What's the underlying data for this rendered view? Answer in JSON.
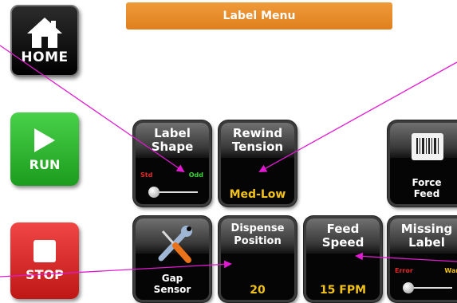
{
  "header": {
    "title": "Label Menu"
  },
  "side_buttons": {
    "home_label": "HOME",
    "run_label": "RUN",
    "stop_label": "STOP"
  },
  "tiles": {
    "label_shape": {
      "title_line1": "Label",
      "title_line2": "Shape",
      "left_text": "Std",
      "right_text": "Odd"
    },
    "rewind_tension": {
      "title_line1": "Rewind",
      "title_line2": "Tension",
      "value": "Med-Low"
    },
    "force_feed": {
      "bottom_line1": "Force",
      "bottom_line2": "Feed"
    },
    "gap_sensor": {
      "bottom_line1": "Gap",
      "bottom_line2": "Sensor"
    },
    "dispense_position": {
      "title_line1": "Dispense",
      "title_line2": "Position",
      "value": "20"
    },
    "feed_speed": {
      "title_line1": "Feed",
      "title_line2": "Speed",
      "value": "15 FPM"
    },
    "missing_label": {
      "title_line1": "Missing",
      "title_line2": "Label",
      "left_text": "Error",
      "right_text": "Warn"
    }
  },
  "colors": {
    "title_bar": "#e8891f",
    "tile_bg": "#050505",
    "value_text": "#f2c21a",
    "run": "#2fb52f",
    "stop": "#d82020",
    "callout_line": "#e01ad0"
  }
}
